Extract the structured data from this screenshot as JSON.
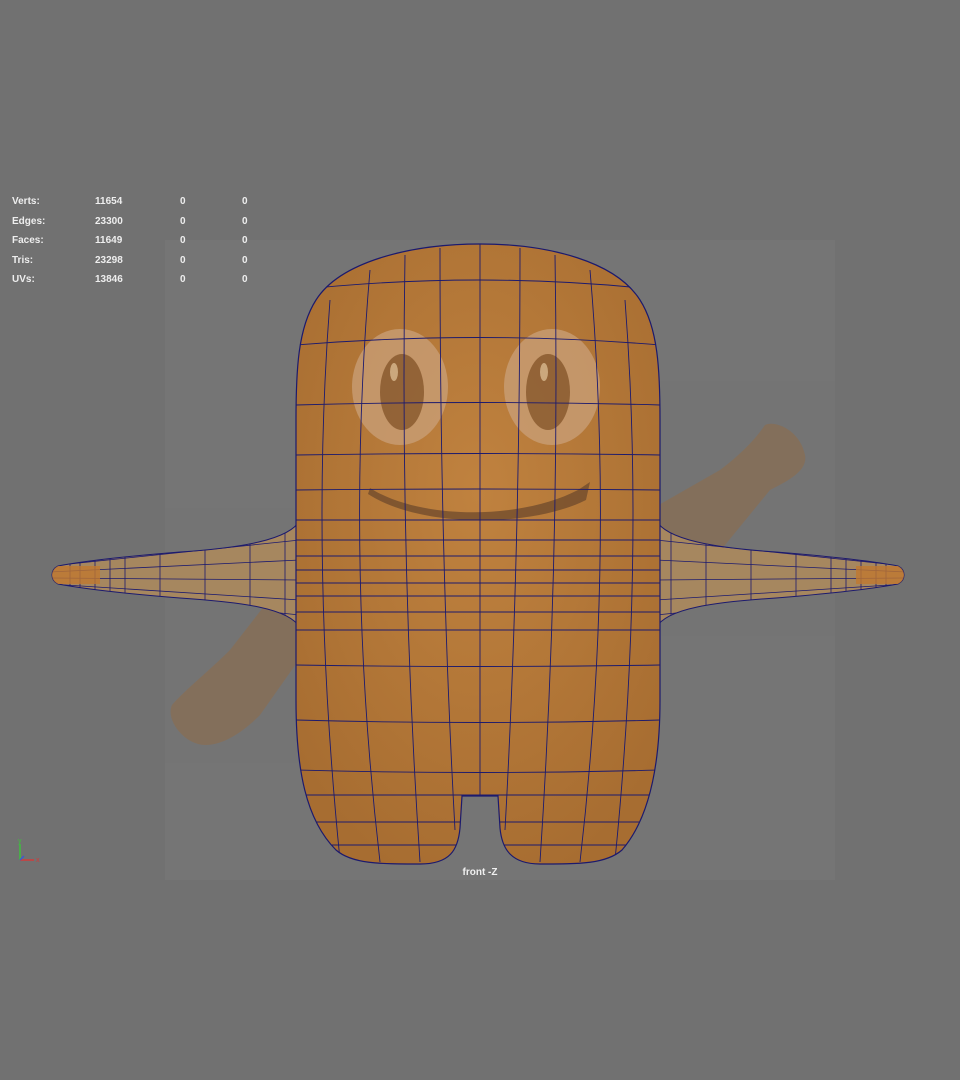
{
  "hud": {
    "rows": [
      {
        "label": "Verts:",
        "total": "11654",
        "selected": "0",
        "component": "0"
      },
      {
        "label": "Edges:",
        "total": "23300",
        "selected": "0",
        "component": "0"
      },
      {
        "label": "Faces:",
        "total": "11649",
        "selected": "0",
        "component": "0"
      },
      {
        "label": "Tris:",
        "total": "23298",
        "selected": "0",
        "component": "0"
      },
      {
        "label": "UVs:",
        "total": "13846",
        "selected": "0",
        "component": "0"
      }
    ]
  },
  "viewport": {
    "camera_label": "front -Z",
    "background_color": "#717171",
    "mesh_color": "#b8793a",
    "wire_color": "#1c1a6e",
    "reference_image": "waving-mascot-reference"
  },
  "axis_gizmo": {
    "y_label": "y",
    "x_label": "x",
    "y_color": "#3fbf3f",
    "x_color": "#d23a3a"
  }
}
